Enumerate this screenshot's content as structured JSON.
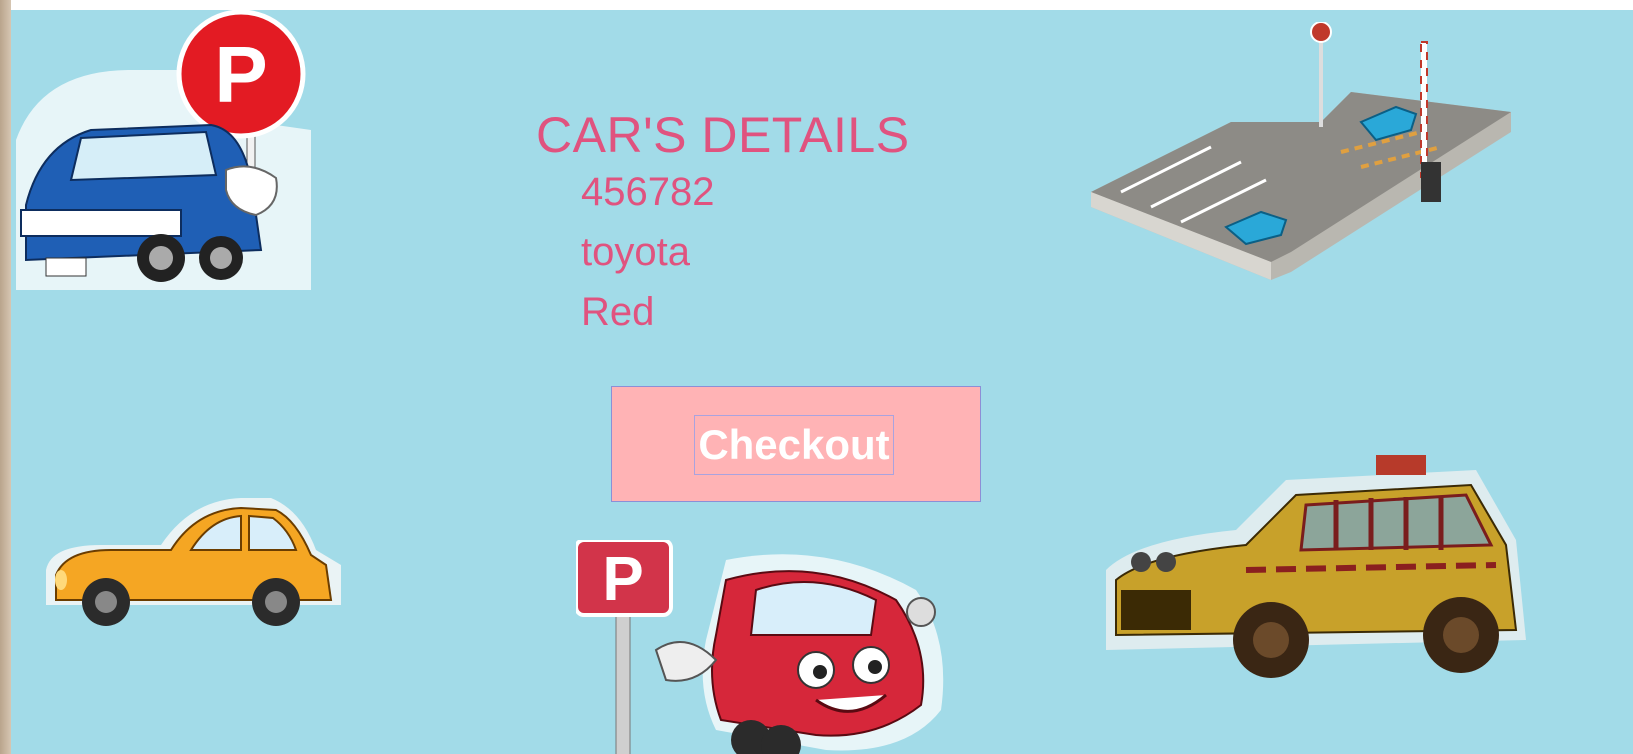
{
  "details": {
    "title": "CAR'S DETAILS",
    "number": "456782",
    "make": "toyota",
    "color": "Red"
  },
  "actions": {
    "checkout_label": "Checkout"
  },
  "signs": {
    "parking_letter": "P"
  },
  "colors": {
    "background": "#a2dbe8",
    "text": "#e0537f",
    "button_panel": "#ffb3b5"
  }
}
